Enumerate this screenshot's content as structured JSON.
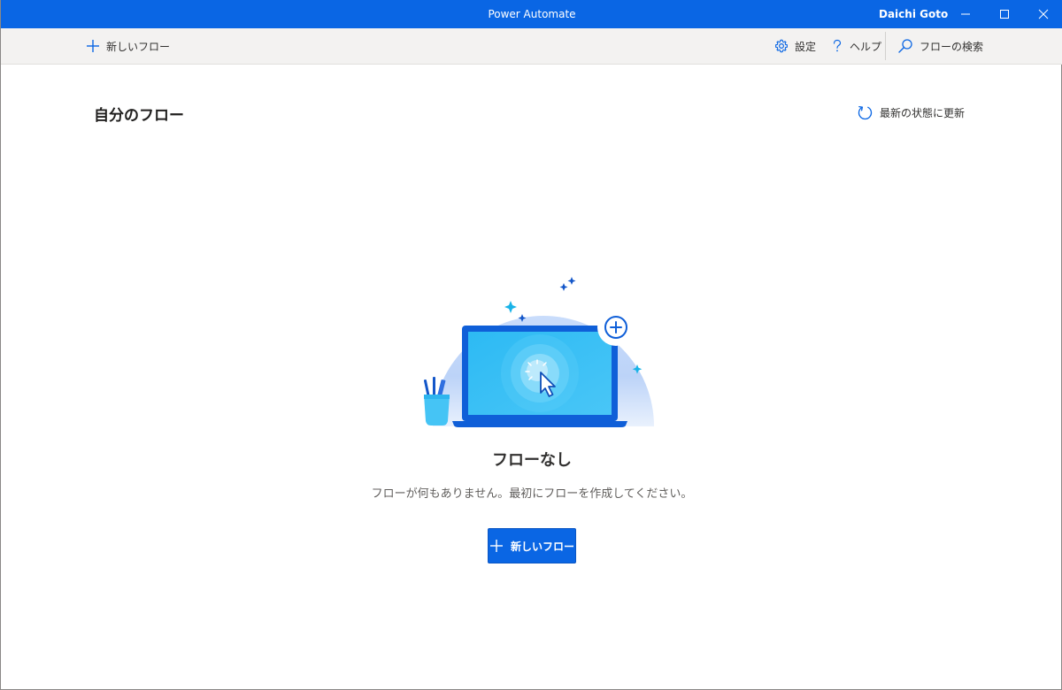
{
  "window": {
    "title": "Power Automate",
    "user": "Daichi Goto",
    "accent_color": "#0a66e4"
  },
  "commandbar": {
    "new_flow_label": "新しいフロー",
    "settings_label": "設定",
    "help_label": "ヘルプ",
    "search_label": "フローの検索"
  },
  "main": {
    "page_title": "自分のフロー",
    "refresh_label": "最新の状態に更新",
    "empty_title": "フローなし",
    "empty_description": "フローが何もありません。最初にフローを作成してください。",
    "new_flow_button_label": "新しいフロー"
  },
  "icons": {
    "new": "plus-icon",
    "settings": "gear-icon",
    "help": "question-icon",
    "search": "search-icon",
    "refresh": "refresh-icon",
    "minimize": "minimize-icon",
    "maximize": "maximize-icon",
    "close": "close-icon"
  }
}
